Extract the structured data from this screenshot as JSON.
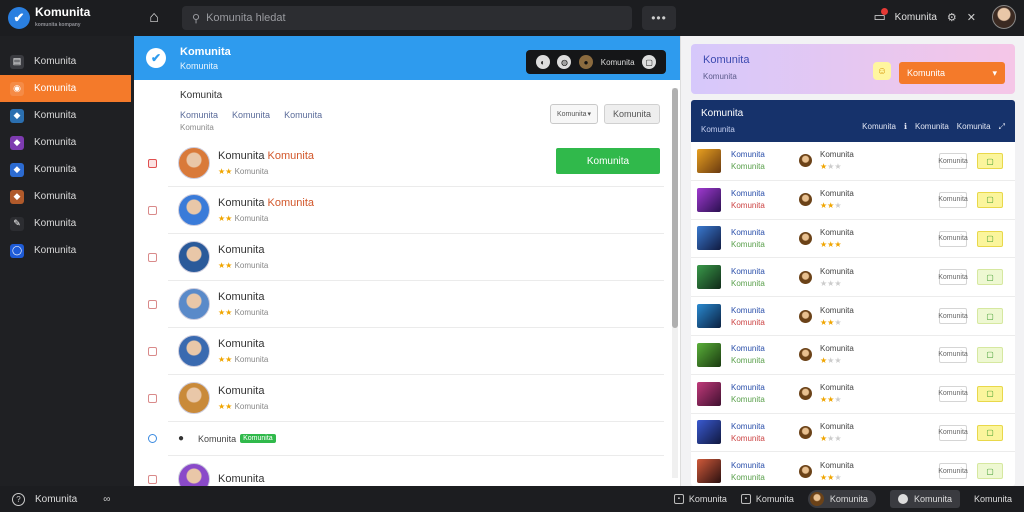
{
  "app": {
    "name": "Komunita",
    "tagline": "komunita kompany"
  },
  "topbar": {
    "search_placeholder": "Komunita hledat",
    "more_label": "•••",
    "user_label": "Komunita",
    "notifications": 1,
    "icons": [
      "home-icon",
      "search-icon",
      "bell-icon",
      "gear-icon",
      "close-icon"
    ]
  },
  "sidebar": {
    "items": [
      {
        "label": "Komunita",
        "icon": "book-icon",
        "color": "#3a3b40"
      },
      {
        "label": "Komunita",
        "icon": "gamepad-icon",
        "color": "#f47a2a",
        "active": true
      },
      {
        "label": "Komunita",
        "icon": "game-art-icon",
        "color": "#2b6fb0"
      },
      {
        "label": "Komunita",
        "icon": "game-art-icon",
        "color": "#7d3bb0"
      },
      {
        "label": "Komunita",
        "icon": "game-art-icon",
        "color": "#2c6bd1"
      },
      {
        "label": "Komunita",
        "icon": "game-art-icon",
        "color": "#b05a2b"
      },
      {
        "label": "Komunita",
        "icon": "chat-icon",
        "color": "#2c2d31"
      },
      {
        "label": "Komunita",
        "icon": "globe-icon",
        "color": "#1e5bd6"
      }
    ]
  },
  "center": {
    "header_title": "Komunita",
    "header_subtitle": "Komunita",
    "tools_text": "Komunita",
    "section_label": "Komunita",
    "filters": [
      "Komunita",
      "Komunita",
      "Komunita"
    ],
    "filters_note": "Komunita",
    "sort_label": "Komunita",
    "sort_button": "Komunita",
    "online_button": "Komunita",
    "rows": [
      {
        "name": "Komunita",
        "highlight": "Komunita",
        "meta": "Komunita",
        "stars": 2,
        "checked": true
      },
      {
        "name": "Komunita",
        "highlight": "Komunita",
        "meta": "Komunita",
        "stars": 2,
        "checked": false
      },
      {
        "name": "Komunita",
        "highlight": "",
        "meta": "Komunita",
        "stars": 2,
        "checked": false
      },
      {
        "name": "Komunita",
        "highlight": "",
        "meta": "Komunita",
        "stars": 2,
        "checked": false
      },
      {
        "name": "Komunita",
        "highlight": "",
        "meta": "Komunita",
        "stars": 2,
        "checked": false
      },
      {
        "name": "Komunita",
        "highlight": "",
        "meta": "Komunita",
        "stars": 2,
        "checked": false
      }
    ],
    "small_row": {
      "name": "Komunita",
      "badge": "Komunita"
    },
    "last_row": {
      "name": "Komunita"
    }
  },
  "right": {
    "notice_title": "Komunita",
    "notice_subtitle": "Komunita",
    "notice_button": "Komunita",
    "friends_title": "Komunita",
    "friends_subtitle": "Komunita",
    "friends_tools": [
      "Komunita",
      "Komunita",
      "Komunita"
    ],
    "friends": [
      {
        "name": "Komunita",
        "sub": "Komunita",
        "name2": "Komunita",
        "stars": 1,
        "num": "Komunita",
        "active": true
      },
      {
        "name": "Komunita",
        "sub": "Komunita",
        "name2": "Komunita",
        "stars": 2,
        "num": "Komunita",
        "active": true
      },
      {
        "name": "Komunita",
        "sub": "Komunita",
        "name2": "Komunita",
        "stars": 3,
        "num": "Komunita",
        "active": true
      },
      {
        "name": "Komunita",
        "sub": "Komunita",
        "name2": "Komunita",
        "stars": 0,
        "num": "Komunita",
        "active": false
      },
      {
        "name": "Komunita",
        "sub": "Komunita",
        "name2": "Komunita",
        "stars": 2,
        "num": "Komunita",
        "active": false
      },
      {
        "name": "Komunita",
        "sub": "Komunita",
        "name2": "Komunita",
        "stars": 1,
        "num": "Komunita",
        "active": false
      },
      {
        "name": "Komunita",
        "sub": "Komunita",
        "name2": "Komunita",
        "stars": 2,
        "num": "Komunita",
        "active": true
      },
      {
        "name": "Komunita",
        "sub": "Komunita",
        "name2": "Komunita",
        "stars": 1,
        "num": "Komunita",
        "active": true
      },
      {
        "name": "Komunita",
        "sub": "Komunita",
        "name2": "Komunita",
        "stars": 2,
        "num": "Komunita",
        "active": false
      }
    ]
  },
  "bottombar": {
    "status_text": "Komunita",
    "link_text": "Komunita",
    "items": [
      "Komunita",
      "Komunita",
      "Komunita",
      "Komunita",
      "Komunita"
    ]
  },
  "colors": {
    "accent": "#f47a2a",
    "brand": "#2e9bee",
    "online": "#30b94b",
    "navy": "#16326b"
  }
}
